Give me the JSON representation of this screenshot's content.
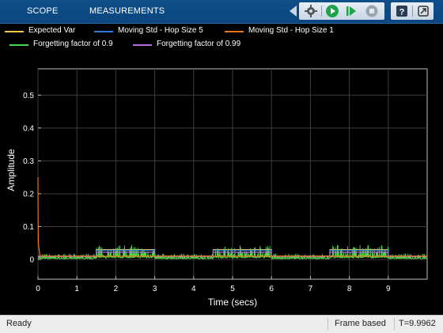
{
  "toolstrip": {
    "tabs": [
      "SCOPE",
      "MEASUREMENTS"
    ],
    "buttons": [
      "settings-icon",
      "run-icon",
      "step-forward-icon",
      "stop-icon",
      "help-icon",
      "undock-icon"
    ]
  },
  "legend": [
    {
      "label": "Expected Var",
      "color": "#f2c94c"
    },
    {
      "label": "Moving Std - Hop Size 5",
      "color": "#2f7fd6"
    },
    {
      "label": "Moving Std - Hop Size 1",
      "color": "#e8751a"
    },
    {
      "label": "Forgetting factor of 0.9",
      "color": "#4cd94c"
    },
    {
      "label": "Forgetting factor of 0.99",
      "color": "#b36ae2"
    }
  ],
  "chart_data": {
    "type": "line",
    "xlabel": "Time (secs)",
    "ylabel": "Amplitude",
    "xlim": [
      0,
      10
    ],
    "ylim": [
      -0.06,
      0.58
    ],
    "xticks": [
      0,
      1,
      2,
      3,
      4,
      5,
      6,
      7,
      8,
      9
    ],
    "yticks": [
      0,
      0.1,
      0.2,
      0.3,
      0.4,
      0.5
    ],
    "grid": true,
    "series": [
      {
        "name": "Expected Var",
        "color": "#f2c94c",
        "x": [
          0,
          1.5,
          1.5,
          3,
          3,
          4.5,
          4.5,
          6,
          6,
          7.5,
          7.5,
          9,
          9,
          10
        ],
        "y": [
          0.01,
          0.01,
          0.03,
          0.03,
          0.01,
          0.01,
          0.03,
          0.03,
          0.01,
          0.01,
          0.03,
          0.03,
          0.01,
          0.01
        ]
      },
      {
        "name": "Moving Std - Hop Size 5",
        "color": "#2f7fd6",
        "x": [
          0,
          1.5,
          1.5,
          3,
          3,
          4.5,
          4.5,
          6,
          6,
          7.5,
          7.5,
          9,
          9,
          10
        ],
        "y": [
          0.01,
          0.01,
          0.028,
          0.028,
          0.01,
          0.01,
          0.028,
          0.028,
          0.01,
          0.01,
          0.028,
          0.028,
          0.01,
          0.01
        ]
      },
      {
        "name": "Moving Std - Hop Size 1",
        "color": "#e8751a",
        "x": [
          0,
          0.005,
          0.01,
          0.05,
          10
        ],
        "y": [
          0.25,
          0.12,
          0.05,
          0.01,
          0.01
        ]
      },
      {
        "name": "Forgetting factor of 0.9",
        "color": "#4cd94c",
        "segments": [
          {
            "x0": 0,
            "x1": 1.5,
            "low": 0.002,
            "high": 0.018
          },
          {
            "x0": 1.5,
            "x1": 3,
            "low": 0.004,
            "high": 0.045
          },
          {
            "x0": 3,
            "x1": 4.5,
            "low": 0.002,
            "high": 0.018
          },
          {
            "x0": 4.5,
            "x1": 6,
            "low": 0.004,
            "high": 0.045
          },
          {
            "x0": 6,
            "x1": 7.5,
            "low": 0.002,
            "high": 0.018
          },
          {
            "x0": 7.5,
            "x1": 9,
            "low": 0.004,
            "high": 0.045
          },
          {
            "x0": 9,
            "x1": 10,
            "low": 0.002,
            "high": 0.018
          }
        ]
      },
      {
        "name": "Forgetting factor of 0.99",
        "color": "#b36ae2",
        "x": [
          0,
          1.5,
          1.5,
          3,
          3,
          4.5,
          4.5,
          6,
          6,
          7.5,
          7.5,
          9,
          9,
          10
        ],
        "y": [
          0.009,
          0.009,
          0.022,
          0.022,
          0.009,
          0.009,
          0.022,
          0.022,
          0.009,
          0.009,
          0.022,
          0.022,
          0.009,
          0.009
        ]
      }
    ]
  },
  "status": {
    "left": "Ready",
    "mode": "Frame based",
    "time": "T=9.9962"
  },
  "colors": {
    "toolstrip": "#0f4f8a",
    "axes_bg": "#000000",
    "grid": "#3c3c3c",
    "axis": "#bfbfbf"
  }
}
